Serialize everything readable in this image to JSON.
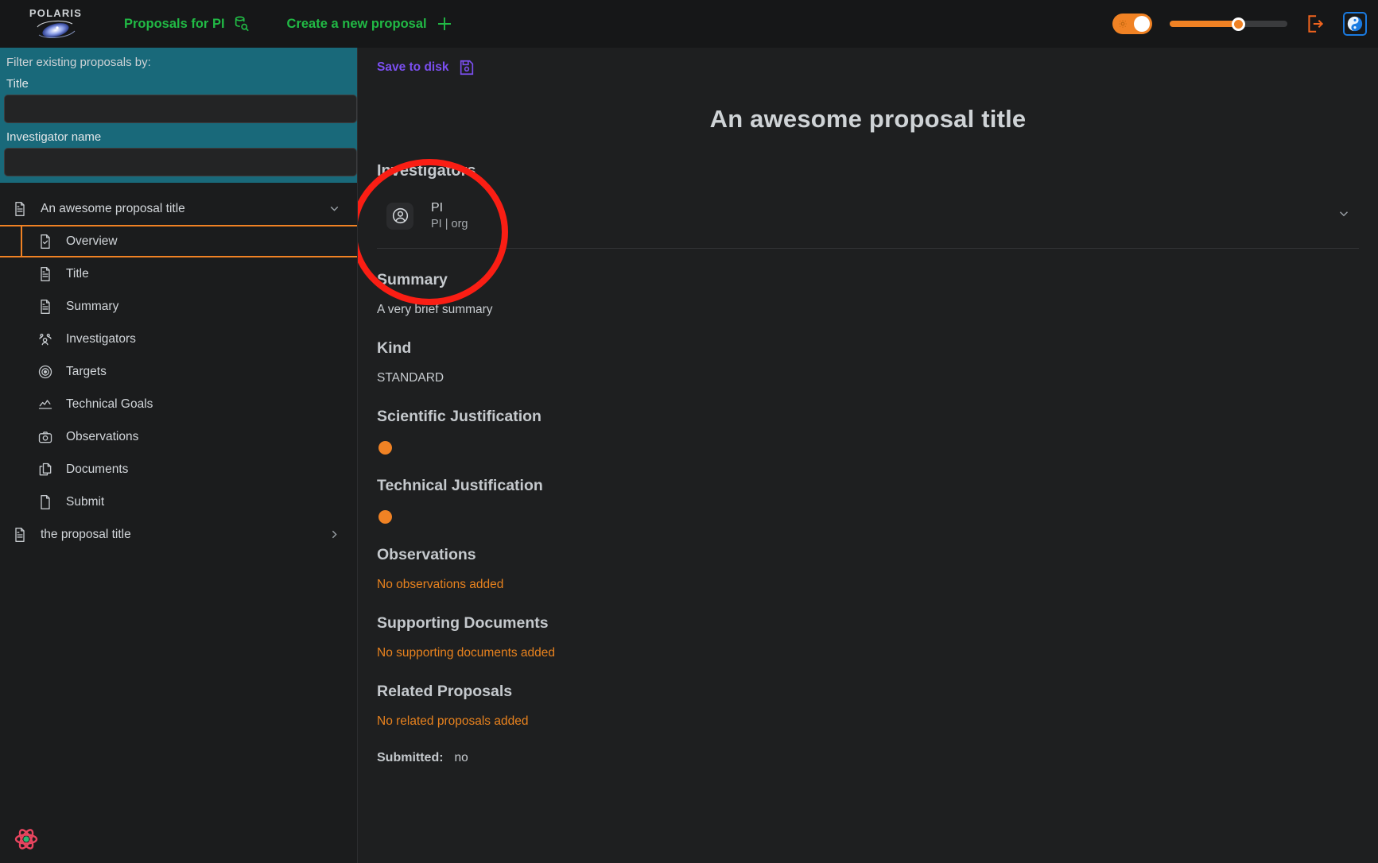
{
  "header": {
    "logo_word": "POLARIS",
    "nav": [
      {
        "label": "Proposals for PI",
        "icon": "database-search-icon"
      },
      {
        "label": "Create a new proposal",
        "icon": "plus-icon"
      }
    ],
    "theme_toggle_icon": "sun-icon",
    "logout_icon": "logout-icon",
    "yinyang_icon": "yin-yang-icon",
    "accent_green": "#21ba45",
    "accent_orange": "#f08224",
    "accent_blue": "#1a7ae0"
  },
  "sidebar": {
    "filter": {
      "heading": "Filter existing proposals by:",
      "title_label": "Title",
      "title_value": "",
      "title_placeholder": "",
      "investigator_label": "Investigator name",
      "investigator_value": "",
      "investigator_placeholder": ""
    },
    "tree": [
      {
        "label": "An awesome proposal title",
        "icon": "file-text-icon",
        "level": 0,
        "selected": false,
        "chevron": "chevron-down-icon"
      },
      {
        "label": "Overview",
        "icon": "file-check-icon",
        "level": 1,
        "selected": true,
        "chevron": ""
      },
      {
        "label": "Title",
        "icon": "file-text-icon",
        "level": 1,
        "selected": false,
        "chevron": ""
      },
      {
        "label": "Summary",
        "icon": "file-text-icon",
        "level": 1,
        "selected": false,
        "chevron": ""
      },
      {
        "label": "Investigators",
        "icon": "users-icon",
        "level": 1,
        "selected": false,
        "chevron": ""
      },
      {
        "label": "Targets",
        "icon": "target-icon",
        "level": 1,
        "selected": false,
        "chevron": ""
      },
      {
        "label": "Technical Goals",
        "icon": "line-chart-icon",
        "level": 1,
        "selected": false,
        "chevron": ""
      },
      {
        "label": "Observations",
        "icon": "camera-icon",
        "level": 1,
        "selected": false,
        "chevron": ""
      },
      {
        "label": "Documents",
        "icon": "copy-documents-icon",
        "level": 1,
        "selected": false,
        "chevron": ""
      },
      {
        "label": "Submit",
        "icon": "file-blank-icon",
        "level": 1,
        "selected": false,
        "chevron": ""
      },
      {
        "label": "the proposal title",
        "icon": "file-text-icon",
        "level": 0,
        "selected": false,
        "chevron": "chevron-right-icon"
      }
    ],
    "footer_icon": "atom-logo-icon"
  },
  "main": {
    "save_label": "Save to disk",
    "save_icon": "floppy-disk-icon",
    "proposal_title": "An awesome proposal title",
    "investigators": {
      "heading": "Investigators",
      "people": [
        {
          "name": "PI",
          "sub": "PI | org",
          "avatar_icon": "user-circle-icon",
          "chevron": "chevron-down-icon"
        }
      ]
    },
    "sections": [
      {
        "key": "summary",
        "heading": "Summary",
        "value": "A very brief summary",
        "kind": "text"
      },
      {
        "key": "kind",
        "heading": "Kind",
        "value": "STANDARD",
        "kind": "text"
      },
      {
        "key": "sci_just",
        "heading": "Scientific Justification",
        "value": "",
        "kind": "dot"
      },
      {
        "key": "tech_just",
        "heading": "Technical Justification",
        "value": "",
        "kind": "dot"
      },
      {
        "key": "observations",
        "heading": "Observations",
        "value": "No observations added",
        "kind": "warn"
      },
      {
        "key": "documents",
        "heading": "Supporting Documents",
        "value": "No supporting documents added",
        "kind": "warn"
      },
      {
        "key": "related",
        "heading": "Related Proposals",
        "value": "No related proposals added",
        "kind": "warn"
      }
    ],
    "submitted_label": "Submitted:",
    "submitted_value": "no"
  },
  "annotation": {
    "shape": "ellipse",
    "color": "#fa1e14"
  }
}
